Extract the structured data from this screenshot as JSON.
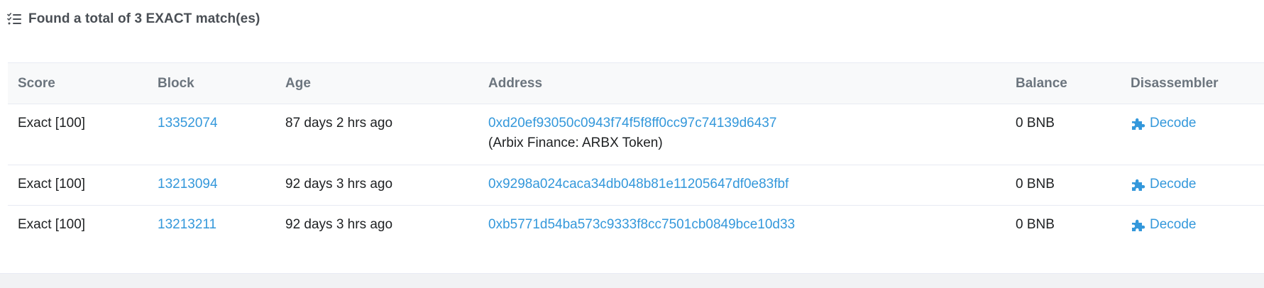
{
  "header": {
    "icon": "list-check-icon",
    "title": "Found a total of 3 EXACT match(es)"
  },
  "table": {
    "columns": [
      "Score",
      "Block",
      "Age",
      "Address",
      "Balance",
      "Disassembler"
    ],
    "rows": [
      {
        "score": "Exact [100]",
        "block": "13352074",
        "age": "87 days 2 hrs ago",
        "address": "0xd20ef93050c0943f74f5f8ff0cc97c74139d6437",
        "address_name": "(Arbix Finance: ARBX Token)",
        "balance": "0 BNB",
        "disassembler": "Decode"
      },
      {
        "score": "Exact [100]",
        "block": "13213094",
        "age": "92 days 3 hrs ago",
        "address": "0x9298a024caca34db048b81e11205647df0e83fbf",
        "balance": "0 BNB",
        "disassembler": "Decode"
      },
      {
        "score": "Exact [100]",
        "block": "13213211",
        "age": "92 days 3 hrs ago",
        "address": "0xb5771d54ba573c9333f8cc7501cb0849bce10d33",
        "balance": "0 BNB",
        "disassembler": "Decode"
      }
    ]
  },
  "colors": {
    "link": "#3498db",
    "header_text": "#4a4f55",
    "column_header": "#6c757e",
    "table_head_bg": "#f8f9fa",
    "border": "#e7eaf3"
  }
}
